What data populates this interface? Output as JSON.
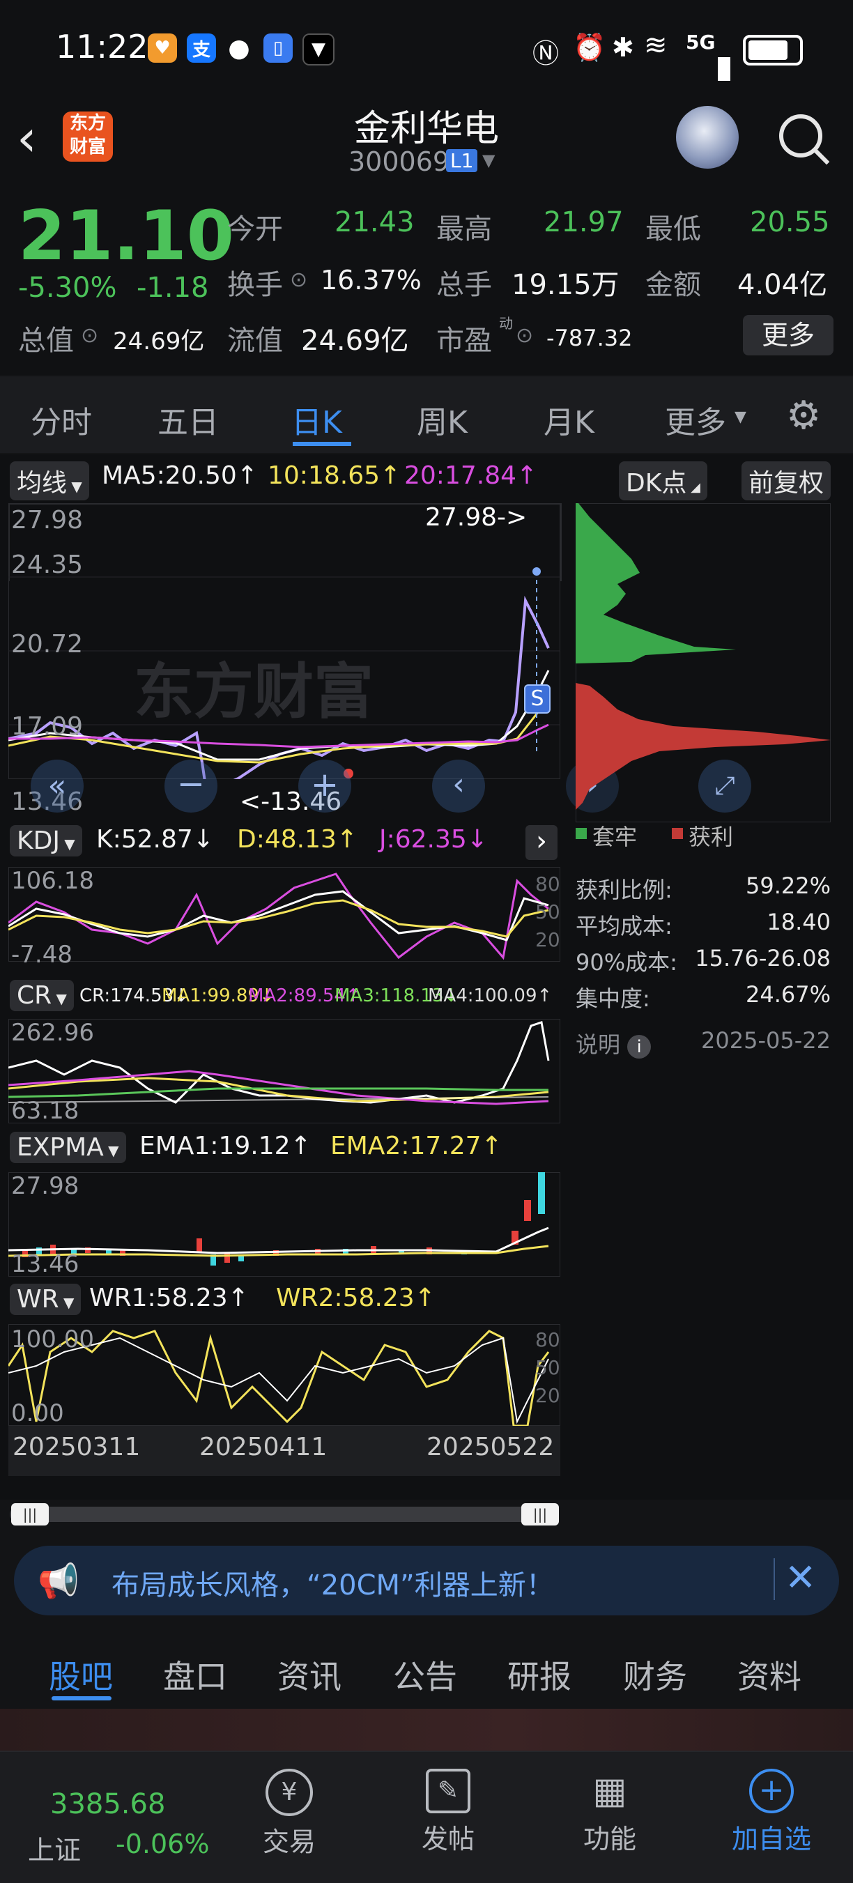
{
  "status_bar": {
    "time": "11:22",
    "battery": "5G"
  },
  "header": {
    "app_logo_line1": "东方",
    "app_logo_line2": "财富",
    "title": "金利华电",
    "code": "300069",
    "level_badge": "L1"
  },
  "quote": {
    "price": "21.10",
    "change_pct": "-5.30%",
    "change": "-1.18",
    "open_label": "今开",
    "open": "21.43",
    "high_label": "最高",
    "high": "21.97",
    "low_label": "最低",
    "low": "20.55",
    "turnover_label": "换手",
    "turnover": "16.37%",
    "volume_label": "总手",
    "volume": "19.15万",
    "amount_label": "金额",
    "amount": "4.04亿",
    "mktcap_label": "总值",
    "mktcap": "24.69亿",
    "float_label": "流值",
    "float_cap": "24.69亿",
    "pe_label": "市盈",
    "pe_sup": "动",
    "pe": "-787.32",
    "more_label": "更多"
  },
  "period_tabs": [
    "分时",
    "五日",
    "日K",
    "周K",
    "月K",
    "更多"
  ],
  "chart": {
    "ma_selector": "均线",
    "ma5": "MA5:20.50↑",
    "ma10": "10:18.65↑",
    "ma20": "20:17.84↑",
    "dk_label": "DK点",
    "adjust_label": "前复权",
    "y_labels": [
      "27.98",
      "24.35",
      "20.72",
      "17.09",
      "13.46"
    ],
    "max_marker": "27.98->",
    "min_marker": "<-13.46",
    "watermark": "东方财富",
    "s_badge": "S",
    "kdj_selector": "KDJ",
    "kdj_k": "K:52.87↓",
    "kdj_d": "D:48.13↑",
    "kdj_j": "J:62.35↓",
    "kdj_y": [
      "106.18",
      "-7.48"
    ],
    "kdj_right": [
      "80",
      "50",
      "20"
    ],
    "cr_selector": "CR",
    "cr_line": "CR:174.53↓",
    "cr_ma1": "MA1:99.89↓",
    "cr_ma2": "MA2:89.54↑",
    "cr_ma3": "MA3:118.13↓",
    "cr_ma4": "MA4:100.09↑",
    "cr_y": [
      "262.96",
      "63.18"
    ],
    "expma_selector": "EXPMA",
    "ema1": "EMA1:19.12↑",
    "ema2": "EMA2:17.27↑",
    "expma_y": [
      "27.98",
      "13.46"
    ],
    "wr_selector": "WR",
    "wr1": "WR1:58.23↑",
    "wr2": "WR2:58.23↑",
    "wr_y": [
      "100.00",
      "0.00"
    ],
    "wr_right": [
      "80",
      "50",
      "20"
    ],
    "x_labels": [
      "20250311",
      "20250411",
      "20250522"
    ]
  },
  "chip": {
    "legend_trapped": "套牢",
    "legend_profit": "获利",
    "rows": [
      {
        "label": "获利比例:",
        "value": "59.22%"
      },
      {
        "label": "平均成本:",
        "value": "18.40"
      },
      {
        "label": "90%成本:",
        "value": "15.76-26.08"
      },
      {
        "label": "集中度:",
        "value": "24.67%"
      }
    ],
    "note_label": "说明",
    "date": "2025-05-22"
  },
  "banner": {
    "text": "布局成长风格，“20CM”利器上新！"
  },
  "content_tabs": [
    "股吧",
    "盘口",
    "资讯",
    "公告",
    "研报",
    "财务",
    "资料"
  ],
  "bottom": {
    "index_value": "3385.68",
    "index_name": "上证",
    "index_change": "-0.06%",
    "nav": [
      "交易",
      "发帖",
      "功能",
      "加自选"
    ]
  },
  "colors": {
    "up": "#e8413c",
    "down": "#4cc25a",
    "accent": "#3d8ef0",
    "ma5": "#ffffff",
    "ma10": "#f3e35b",
    "ma20": "#d94ee0"
  }
}
